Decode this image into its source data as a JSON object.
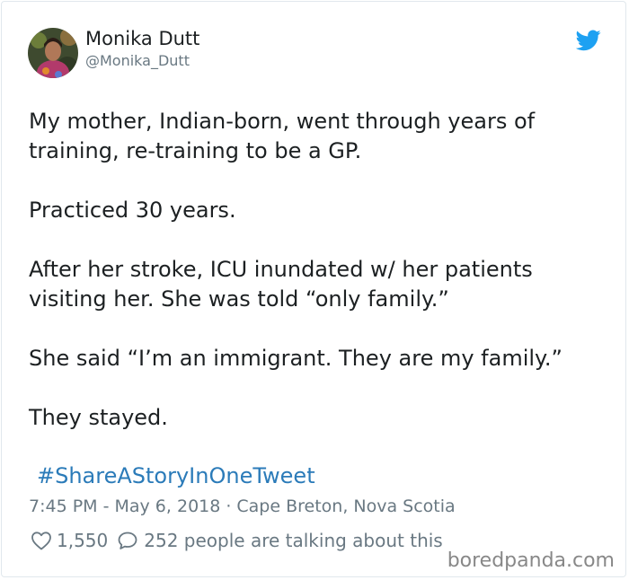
{
  "tweet": {
    "author_name": "Monika Dutt",
    "author_handle": "@Monika_Dutt",
    "paragraphs": [
      "My mother, Indian-born, went through years of training, re-training to be a GP.",
      "Practiced 30 years.",
      "After her stroke, ICU inundated w/ her patients visiting her. She was told “only family.”",
      "She said “I’m an immigrant. They are my family.”",
      "They stayed."
    ],
    "hashtag": "#ShareAStoryInOneTweet",
    "timestamp": "7:45 PM - May 6, 2018",
    "meta_separator": "·",
    "location": "Cape Breton, Nova Scotia",
    "likes": "1,550",
    "replies": "252 people are talking about this"
  },
  "icons": {
    "platform": "twitter-bird-icon",
    "like": "heart-icon",
    "reply": "speech-bubble-icon"
  },
  "colors": {
    "link": "#2b7bb9",
    "brand": "#1da1f2",
    "muted": "#697882",
    "text": "#1c2022"
  },
  "watermark": "boredpanda.com"
}
